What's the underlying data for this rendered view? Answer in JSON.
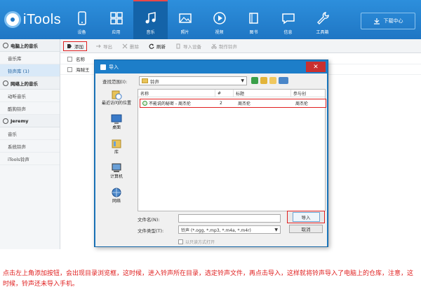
{
  "app": {
    "name": "iTools"
  },
  "nav": [
    {
      "label": "设备",
      "icon": "phone-icon"
    },
    {
      "label": "应用",
      "icon": "apps-icon"
    },
    {
      "label": "音乐",
      "icon": "music-note-icon",
      "active": true
    },
    {
      "label": "照片",
      "icon": "photo-icon"
    },
    {
      "label": "视频",
      "icon": "video-play-icon"
    },
    {
      "label": "图书",
      "icon": "book-icon"
    },
    {
      "label": "信息",
      "icon": "message-icon"
    },
    {
      "label": "工具箱",
      "icon": "wrench-icon"
    }
  ],
  "download_center": "下载中心",
  "sidebar": {
    "section1": "电脑上的音乐",
    "section1_items": [
      "音乐库",
      "铃声库 (1)"
    ],
    "section2": "网络上的音乐",
    "section2_items": [
      "动听音乐",
      "酷狗铃声"
    ],
    "section3": "Jeremy",
    "section3_items": [
      "音乐",
      "系统铃声",
      "iTools铃声"
    ]
  },
  "toolbar": {
    "add": "添加",
    "export": "导出",
    "delete": "删除",
    "refresh": "刷新",
    "import_device": "导入设备",
    "make_ringtone": "制作铃声"
  },
  "list": {
    "header": "名称",
    "row1": "海贼王"
  },
  "dialog": {
    "title": "导入",
    "look_in_label": "查找范围(I):",
    "look_in_value": "铃声",
    "places": [
      "最近访问的位置",
      "桌面",
      "库",
      "计算机",
      "网络"
    ],
    "columns": [
      "名称",
      "#",
      "标题",
      "参与创"
    ],
    "file": {
      "name": "不能说的秘密 - 周杰伦",
      "track": "2",
      "title": "周杰伦",
      "artist": "周杰伦"
    },
    "filename_label": "文件名(N):",
    "filetype_label": "文件类型(T):",
    "filetype_value": "铃声 (*.ogg, *.mp3, *.m4a, *.m4r)",
    "import_button": "导入",
    "cancel_button": "取消",
    "readonly_label": "以只读方式打开"
  },
  "caption": "点击左上角添加按钮，会出现目录浏览框，这时候，进入铃声所在目录，选定铃声文件，再点击导入，这样就将铃声导入了电脑上的仓库，注意，这时候，铃声还未导入手机。",
  "colors": {
    "topbar": "#1f76c4",
    "highlight": "#e02020",
    "dialog_frame": "#1d7ec9"
  }
}
